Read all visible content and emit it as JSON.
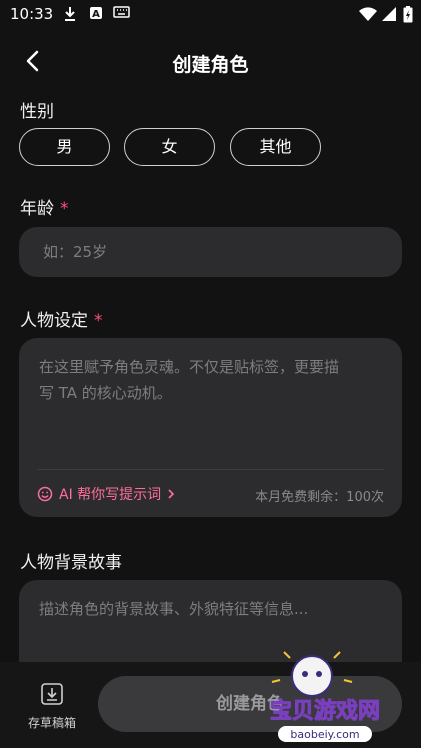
{
  "status_bar": {
    "time": "10:33"
  },
  "header": {
    "title": "创建角色"
  },
  "gender": {
    "label": "性别",
    "options": [
      "男",
      "女",
      "其他"
    ]
  },
  "age": {
    "label": "年龄",
    "required_mark": "*",
    "placeholder": "如：25岁"
  },
  "persona": {
    "label": "人物设定",
    "required_mark": "*",
    "placeholder_line1": "在这里赋予角色灵魂。不仅是贴标签，更要描",
    "placeholder_line2": "写 TA 的核心动机。",
    "ai_helper": "AI 帮你写提示词",
    "quota": "本月免费剩余：100次"
  },
  "backstory": {
    "label": "人物背景故事",
    "placeholder": "描述角色的背景故事、外貌特征等信息..."
  },
  "bottom_bar": {
    "draft_label": "存草稿箱",
    "create_label": "创建角色"
  },
  "watermark": {
    "brand": "宝贝游戏网",
    "url": "baobeiy.com"
  },
  "colors": {
    "accent": "#ff6e9a",
    "required": "#ff4f7b",
    "field_bg": "#2c2c2e"
  }
}
